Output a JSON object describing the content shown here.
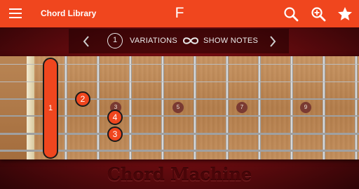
{
  "appbar": {
    "title": "Chord Library",
    "chord_name": "F",
    "icons": [
      "menu-icon",
      "search-icon",
      "zoom-in-icon",
      "star-icon"
    ],
    "color": "#f0461e"
  },
  "variations_bar": {
    "current": "1",
    "variations_label": "VARIATIONS",
    "show_notes_label": "SHOW NOTES",
    "icons": [
      "chevron-left-icon",
      "infinity-icon",
      "chevron-right-icon"
    ]
  },
  "fretboard": {
    "fret_markers": [
      "3",
      "5",
      "7",
      "9"
    ],
    "barre": {
      "finger": "1",
      "fret": 1
    },
    "fingers": [
      {
        "finger": "2",
        "fret": 2,
        "string": "G"
      },
      {
        "finger": "4",
        "fret": 3,
        "string": "D"
      },
      {
        "finger": "3",
        "fret": 3,
        "string": "A"
      }
    ]
  },
  "branding": "Chord Machine"
}
